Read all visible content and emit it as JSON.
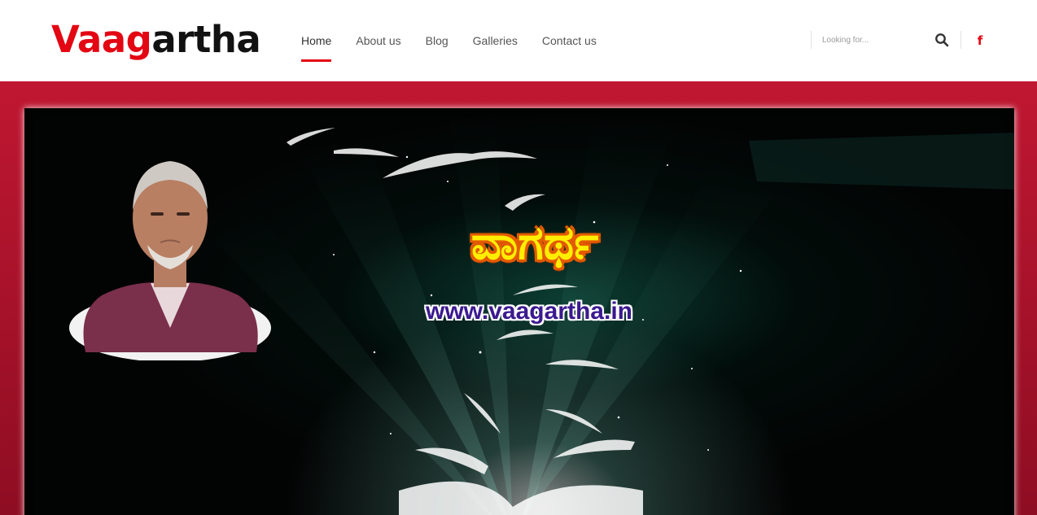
{
  "site": {
    "logo_part1": "Vaag",
    "logo_part2": "artha"
  },
  "nav": {
    "items": [
      {
        "label": "Home",
        "active": true
      },
      {
        "label": "About us",
        "active": false
      },
      {
        "label": "Blog",
        "active": false
      },
      {
        "label": "Galleries",
        "active": false
      },
      {
        "label": "Contact us",
        "active": false
      }
    ]
  },
  "search": {
    "placeholder": "Looking for..."
  },
  "social": {
    "facebook_glyph": "f",
    "facebook_icon": "facebook-icon"
  },
  "banner": {
    "kannada_title": "ವಾಗರ್ಥ",
    "url": "www.vaagartha.in"
  },
  "colors": {
    "brand_red": "#e30613",
    "frame_red": "#a0122a",
    "title_yellow": "#ffee00",
    "url_purple": "#3b1a8f"
  }
}
